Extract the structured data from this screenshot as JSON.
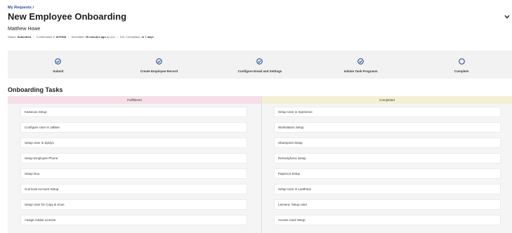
{
  "breadcrumb": "My Requests /",
  "title": "New Employee Onboarding",
  "requester": "Matthew Howe",
  "meta": {
    "status_label": "Status:",
    "status_value": "Submitted",
    "confirmation_label": "Confirmation #:",
    "confirmation_value": "8CF808",
    "submitted_label": "Submitted:",
    "submitted_value": "25 minutes ago",
    "submitted_by": "by you",
    "completion_label": "Est. Completion:",
    "completion_value": "in 7 days"
  },
  "steps": [
    {
      "label": "Submit",
      "status": "done"
    },
    {
      "label": "Create Employee Record",
      "status": "done"
    },
    {
      "label": "Configure Email and Settings",
      "status": "done"
    },
    {
      "label": "Initiate Task Programs",
      "status": "done"
    },
    {
      "label": "Complete",
      "status": "pending"
    }
  ],
  "tasks_title": "Onboarding Tasks",
  "lanes": {
    "fulfillment": {
      "header": "Fulfillment",
      "tasks": [
        "Kaiseous Setup",
        "Configure User in Jabber",
        "Setup User in Episys",
        "Setup Employee Phone",
        "Setup Duo",
        "Curricula Account Setup",
        "Setup User for Copy & Scan",
        "Assign Adobe License"
      ]
    },
    "completed": {
      "header": "Completed",
      "tasks": [
        "Setup User in Xperience",
        "Workstation Setup",
        "Sharepoint Setup",
        "Remedyforce Setup",
        "Papercut Setup",
        "Setup User in LastPass",
        "Lanvera: Setup User",
        "Access Card Setup"
      ]
    }
  },
  "colors": {
    "accent": "#1f4e96",
    "fulfillment_header": "#f6dfe8",
    "completed_header": "#f4f0d6"
  }
}
